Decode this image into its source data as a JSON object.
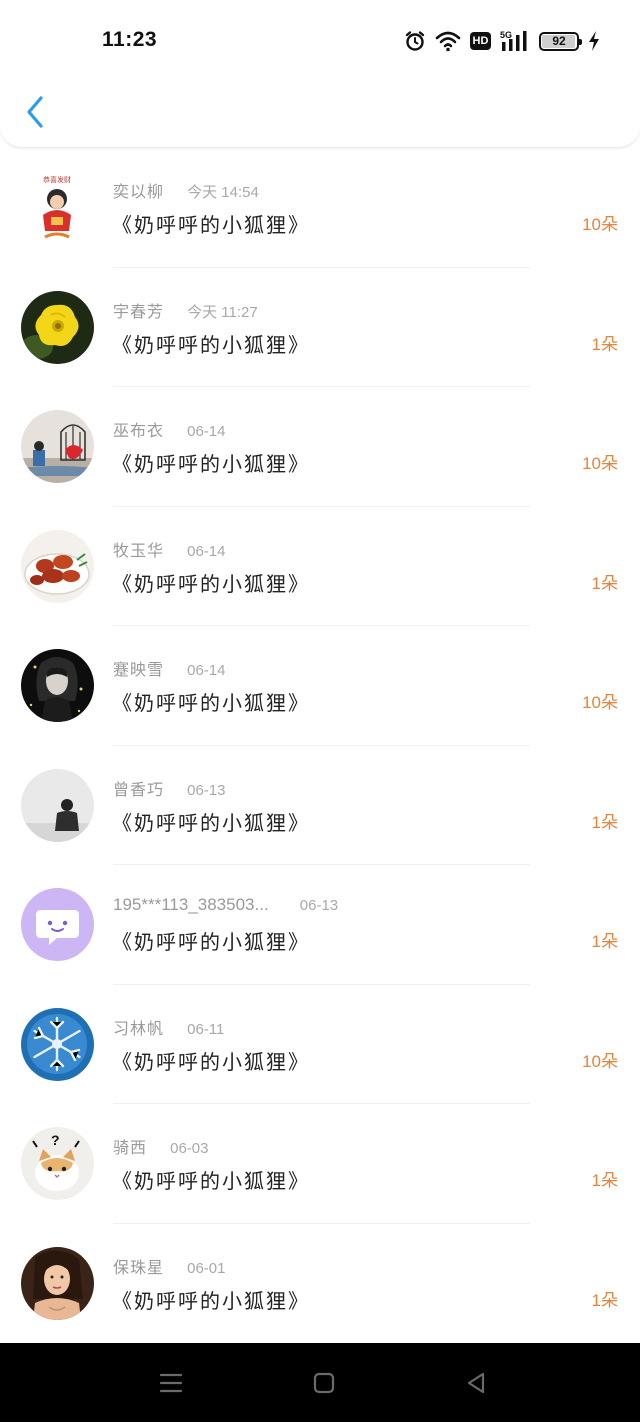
{
  "status_bar": {
    "time": "11:23",
    "network": "5G",
    "hd_label": "HD",
    "battery": "92",
    "icons": [
      "alarm-icon",
      "wifi-icon",
      "hd-icon",
      "signal-icon",
      "battery-icon",
      "charging-icon"
    ]
  },
  "header": {
    "back_icon": "chevron-left-icon",
    "accent": "#2b9de6"
  },
  "list": [
    {
      "name": "奕以柳",
      "time": "今天 14:54",
      "title": "《奶呼呼的小狐狸》",
      "count": "10朵"
    },
    {
      "name": "宇春芳",
      "time": "今天 11:27",
      "title": "《奶呼呼的小狐狸》",
      "count": "1朵"
    },
    {
      "name": "巫布衣",
      "time": "06-14",
      "title": "《奶呼呼的小狐狸》",
      "count": "10朵"
    },
    {
      "name": "牧玉华",
      "time": "06-14",
      "title": "《奶呼呼的小狐狸》",
      "count": "1朵"
    },
    {
      "name": "蹇映雪",
      "time": "06-14",
      "title": "《奶呼呼的小狐狸》",
      "count": "10朵"
    },
    {
      "name": "曾香巧",
      "time": "06-13",
      "title": "《奶呼呼的小狐狸》",
      "count": "1朵"
    },
    {
      "name": "195***113_383503...",
      "time": "06-13",
      "title": "《奶呼呼的小狐狸》",
      "count": "1朵"
    },
    {
      "name": "习林帆",
      "time": "06-11",
      "title": "《奶呼呼的小狐狸》",
      "count": "10朵"
    },
    {
      "name": "骑西",
      "time": "06-03",
      "title": "《奶呼呼的小狐狸》",
      "count": "1朵"
    },
    {
      "name": "保珠星",
      "time": "06-01",
      "title": "《奶呼呼的小狐狸》",
      "count": "1朵"
    }
  ],
  "colors": {
    "count": "#e5843a",
    "name": "#9a9a9a",
    "title": "#222222"
  },
  "nav_bar": {
    "icons": [
      "menu-icon",
      "home-square-icon",
      "back-triangle-icon"
    ]
  }
}
